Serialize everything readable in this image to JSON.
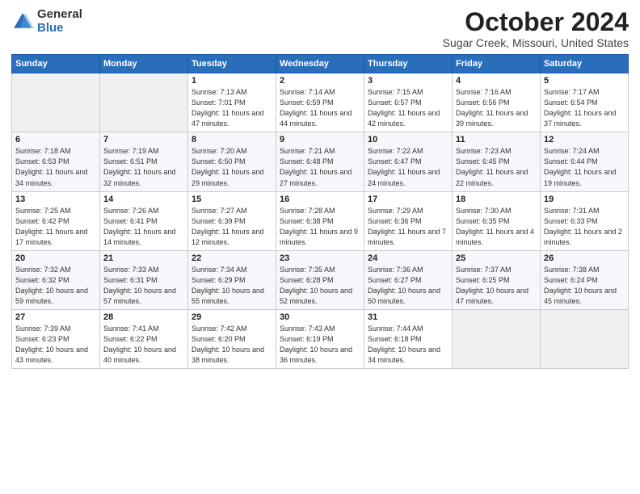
{
  "header": {
    "logo_general": "General",
    "logo_blue": "Blue",
    "month_title": "October 2024",
    "location": "Sugar Creek, Missouri, United States"
  },
  "days_of_week": [
    "Sunday",
    "Monday",
    "Tuesday",
    "Wednesday",
    "Thursday",
    "Friday",
    "Saturday"
  ],
  "weeks": [
    [
      {
        "day": "",
        "sunrise": "",
        "sunset": "",
        "daylight": "",
        "empty": true
      },
      {
        "day": "",
        "sunrise": "",
        "sunset": "",
        "daylight": "",
        "empty": true
      },
      {
        "day": "1",
        "sunrise": "Sunrise: 7:13 AM",
        "sunset": "Sunset: 7:01 PM",
        "daylight": "Daylight: 11 hours and 47 minutes."
      },
      {
        "day": "2",
        "sunrise": "Sunrise: 7:14 AM",
        "sunset": "Sunset: 6:59 PM",
        "daylight": "Daylight: 11 hours and 44 minutes."
      },
      {
        "day": "3",
        "sunrise": "Sunrise: 7:15 AM",
        "sunset": "Sunset: 6:57 PM",
        "daylight": "Daylight: 11 hours and 42 minutes."
      },
      {
        "day": "4",
        "sunrise": "Sunrise: 7:16 AM",
        "sunset": "Sunset: 6:56 PM",
        "daylight": "Daylight: 11 hours and 39 minutes."
      },
      {
        "day": "5",
        "sunrise": "Sunrise: 7:17 AM",
        "sunset": "Sunset: 6:54 PM",
        "daylight": "Daylight: 11 hours and 37 minutes."
      }
    ],
    [
      {
        "day": "6",
        "sunrise": "Sunrise: 7:18 AM",
        "sunset": "Sunset: 6:53 PM",
        "daylight": "Daylight: 11 hours and 34 minutes."
      },
      {
        "day": "7",
        "sunrise": "Sunrise: 7:19 AM",
        "sunset": "Sunset: 6:51 PM",
        "daylight": "Daylight: 11 hours and 32 minutes."
      },
      {
        "day": "8",
        "sunrise": "Sunrise: 7:20 AM",
        "sunset": "Sunset: 6:50 PM",
        "daylight": "Daylight: 11 hours and 29 minutes."
      },
      {
        "day": "9",
        "sunrise": "Sunrise: 7:21 AM",
        "sunset": "Sunset: 6:48 PM",
        "daylight": "Daylight: 11 hours and 27 minutes."
      },
      {
        "day": "10",
        "sunrise": "Sunrise: 7:22 AM",
        "sunset": "Sunset: 6:47 PM",
        "daylight": "Daylight: 11 hours and 24 minutes."
      },
      {
        "day": "11",
        "sunrise": "Sunrise: 7:23 AM",
        "sunset": "Sunset: 6:45 PM",
        "daylight": "Daylight: 11 hours and 22 minutes."
      },
      {
        "day": "12",
        "sunrise": "Sunrise: 7:24 AM",
        "sunset": "Sunset: 6:44 PM",
        "daylight": "Daylight: 11 hours and 19 minutes."
      }
    ],
    [
      {
        "day": "13",
        "sunrise": "Sunrise: 7:25 AM",
        "sunset": "Sunset: 6:42 PM",
        "daylight": "Daylight: 11 hours and 17 minutes."
      },
      {
        "day": "14",
        "sunrise": "Sunrise: 7:26 AM",
        "sunset": "Sunset: 6:41 PM",
        "daylight": "Daylight: 11 hours and 14 minutes."
      },
      {
        "day": "15",
        "sunrise": "Sunrise: 7:27 AM",
        "sunset": "Sunset: 6:39 PM",
        "daylight": "Daylight: 11 hours and 12 minutes."
      },
      {
        "day": "16",
        "sunrise": "Sunrise: 7:28 AM",
        "sunset": "Sunset: 6:38 PM",
        "daylight": "Daylight: 11 hours and 9 minutes."
      },
      {
        "day": "17",
        "sunrise": "Sunrise: 7:29 AM",
        "sunset": "Sunset: 6:36 PM",
        "daylight": "Daylight: 11 hours and 7 minutes."
      },
      {
        "day": "18",
        "sunrise": "Sunrise: 7:30 AM",
        "sunset": "Sunset: 6:35 PM",
        "daylight": "Daylight: 11 hours and 4 minutes."
      },
      {
        "day": "19",
        "sunrise": "Sunrise: 7:31 AM",
        "sunset": "Sunset: 6:33 PM",
        "daylight": "Daylight: 11 hours and 2 minutes."
      }
    ],
    [
      {
        "day": "20",
        "sunrise": "Sunrise: 7:32 AM",
        "sunset": "Sunset: 6:32 PM",
        "daylight": "Daylight: 10 hours and 59 minutes."
      },
      {
        "day": "21",
        "sunrise": "Sunrise: 7:33 AM",
        "sunset": "Sunset: 6:31 PM",
        "daylight": "Daylight: 10 hours and 57 minutes."
      },
      {
        "day": "22",
        "sunrise": "Sunrise: 7:34 AM",
        "sunset": "Sunset: 6:29 PM",
        "daylight": "Daylight: 10 hours and 55 minutes."
      },
      {
        "day": "23",
        "sunrise": "Sunrise: 7:35 AM",
        "sunset": "Sunset: 6:28 PM",
        "daylight": "Daylight: 10 hours and 52 minutes."
      },
      {
        "day": "24",
        "sunrise": "Sunrise: 7:36 AM",
        "sunset": "Sunset: 6:27 PM",
        "daylight": "Daylight: 10 hours and 50 minutes."
      },
      {
        "day": "25",
        "sunrise": "Sunrise: 7:37 AM",
        "sunset": "Sunset: 6:25 PM",
        "daylight": "Daylight: 10 hours and 47 minutes."
      },
      {
        "day": "26",
        "sunrise": "Sunrise: 7:38 AM",
        "sunset": "Sunset: 6:24 PM",
        "daylight": "Daylight: 10 hours and 45 minutes."
      }
    ],
    [
      {
        "day": "27",
        "sunrise": "Sunrise: 7:39 AM",
        "sunset": "Sunset: 6:23 PM",
        "daylight": "Daylight: 10 hours and 43 minutes."
      },
      {
        "day": "28",
        "sunrise": "Sunrise: 7:41 AM",
        "sunset": "Sunset: 6:22 PM",
        "daylight": "Daylight: 10 hours and 40 minutes."
      },
      {
        "day": "29",
        "sunrise": "Sunrise: 7:42 AM",
        "sunset": "Sunset: 6:20 PM",
        "daylight": "Daylight: 10 hours and 38 minutes."
      },
      {
        "day": "30",
        "sunrise": "Sunrise: 7:43 AM",
        "sunset": "Sunset: 6:19 PM",
        "daylight": "Daylight: 10 hours and 36 minutes."
      },
      {
        "day": "31",
        "sunrise": "Sunrise: 7:44 AM",
        "sunset": "Sunset: 6:18 PM",
        "daylight": "Daylight: 10 hours and 34 minutes."
      },
      {
        "day": "",
        "sunrise": "",
        "sunset": "",
        "daylight": "",
        "empty": true
      },
      {
        "day": "",
        "sunrise": "",
        "sunset": "",
        "daylight": "",
        "empty": true
      }
    ]
  ]
}
